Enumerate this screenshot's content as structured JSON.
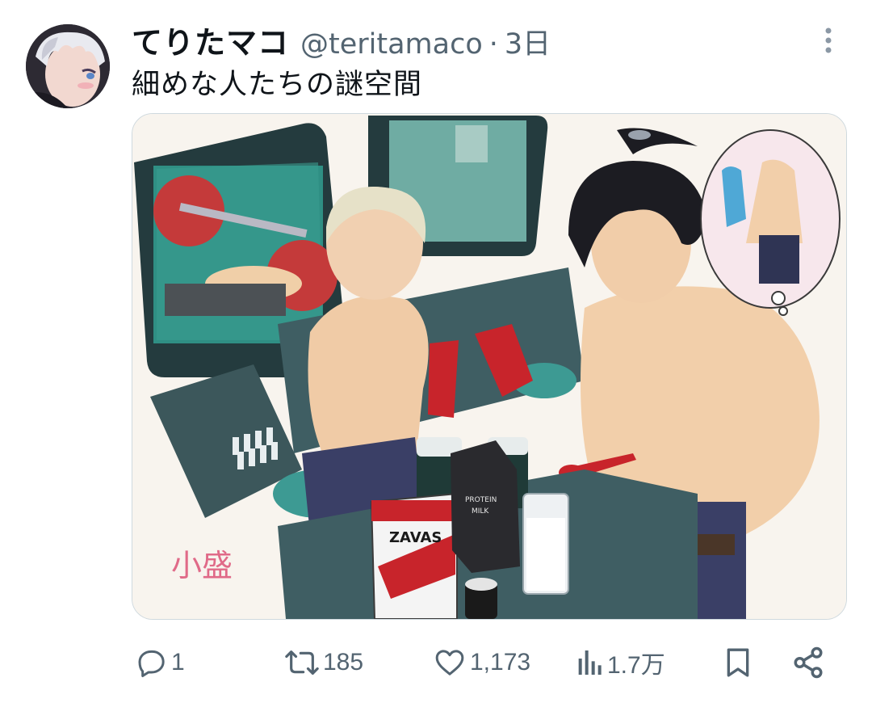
{
  "author": {
    "display_name": "てりたマコ",
    "handle": "@teritamaco",
    "separator": "·",
    "time_ago": "3日"
  },
  "tweet": {
    "text": "細めな人たちの謎空間"
  },
  "media": {
    "package_label": "ZAVAS",
    "carton_label_1": "PROTEIN",
    "carton_label_2": "MILK",
    "caption": "小盛"
  },
  "metrics": {
    "replies": "1",
    "retweets": "185",
    "likes": "1,173",
    "views": "1.7万"
  },
  "colors": {
    "text_primary": "#0f1419",
    "text_secondary": "#536471",
    "border": "#cfd9de"
  },
  "icons": [
    "avatar",
    "more-vertical-icon",
    "reply-icon",
    "retweet-icon",
    "like-icon",
    "views-icon",
    "bookmark-icon",
    "share-icon"
  ]
}
